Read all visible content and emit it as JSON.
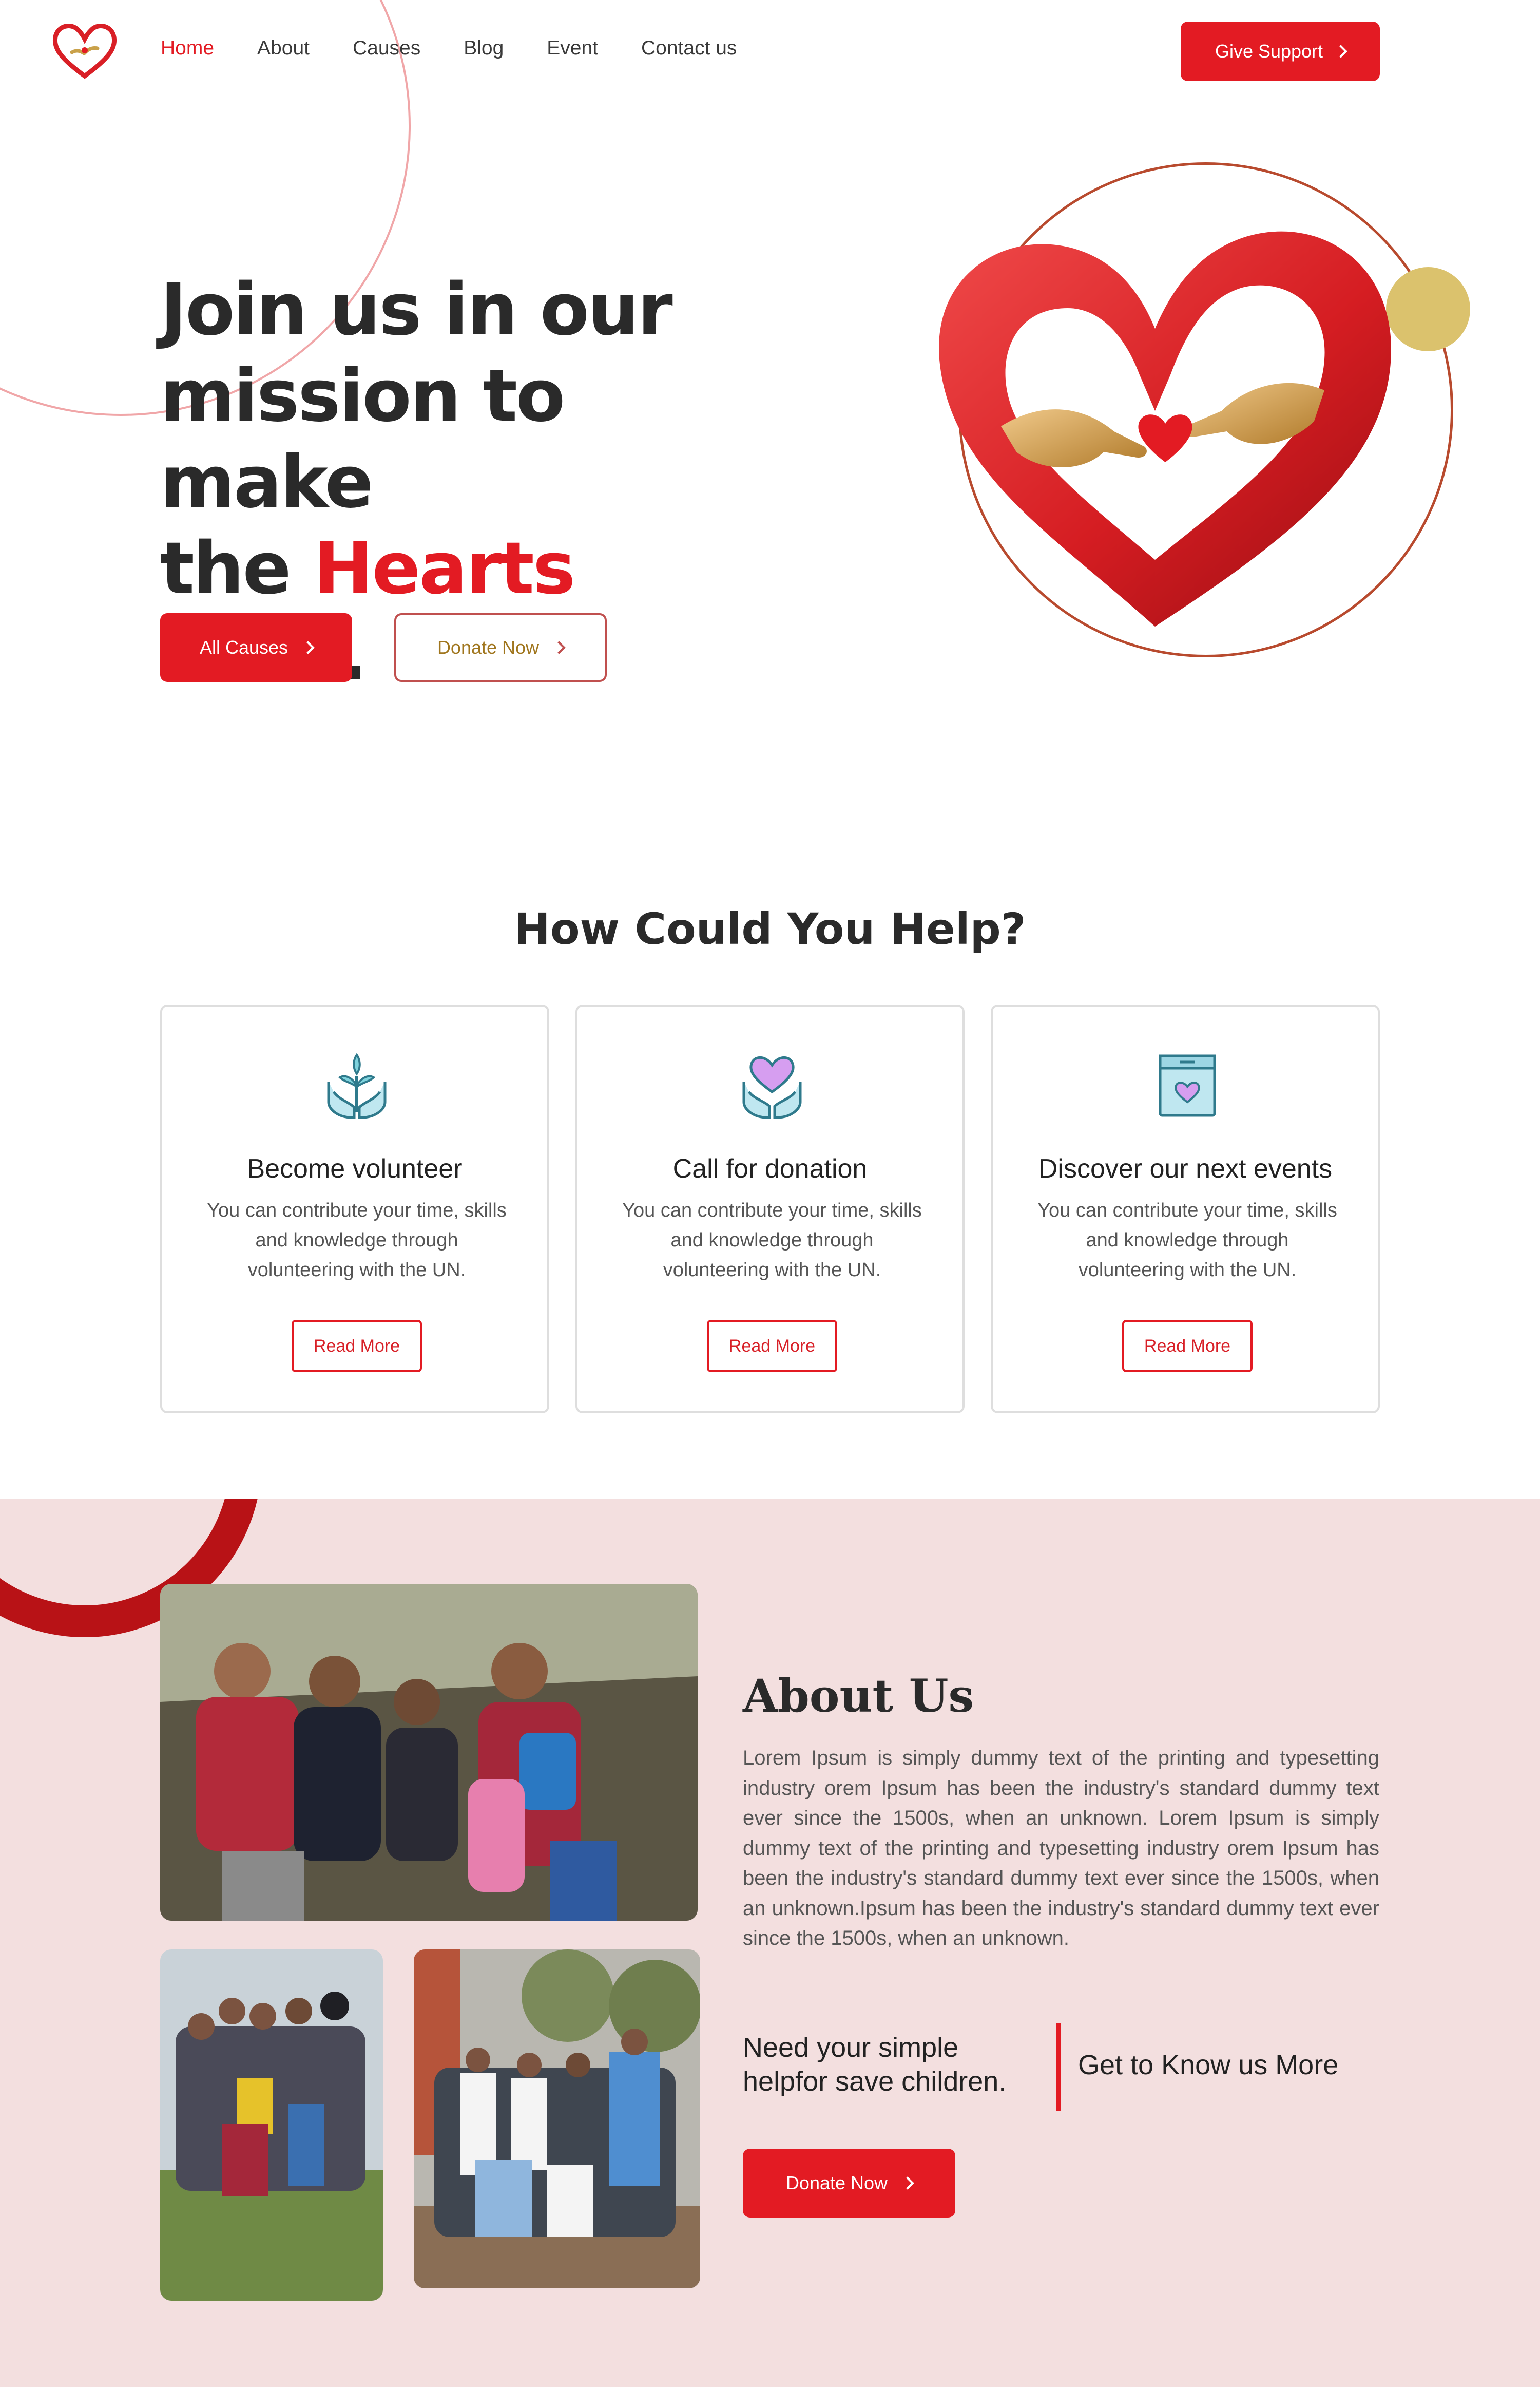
{
  "nav": {
    "links": [
      {
        "label": "Home",
        "active": true
      },
      {
        "label": "About",
        "active": false
      },
      {
        "label": "Causes",
        "active": false
      },
      {
        "label": "Blog",
        "active": false
      },
      {
        "label": "Event",
        "active": false
      },
      {
        "label": "Contact us",
        "active": false
      }
    ],
    "give_support_label": "Give Support"
  },
  "hero": {
    "title_line1": "Join us in our",
    "title_line2": "mission to make",
    "title_line3_pre": "the ",
    "title_line3_accent": "Hearts",
    "title_line3_post": " Beat.",
    "all_causes_label": "All Causes",
    "donate_now_label": "Donate Now"
  },
  "help": {
    "title": "How Could You Help?",
    "cards": [
      {
        "title": "Become volunteer",
        "text": "You can contribute your time, skills and knowledge through volunteering with the UN.",
        "button": "Read More",
        "icon": "volunteer-plant-hands-icon"
      },
      {
        "title": "Call for donation",
        "text": "You can contribute your time, skills and knowledge through volunteering with the UN.",
        "button": "Read More",
        "icon": "heart-hands-icon"
      },
      {
        "title": "Discover our next events",
        "text": "You can contribute your time, skills and knowledge through volunteering with the UN.",
        "button": "Read More",
        "icon": "donation-box-icon"
      }
    ]
  },
  "about": {
    "title": "About Us",
    "text": "Lorem Ipsum is simply dummy text of the printing and typesetting industry orem Ipsum has been the industry's standard dummy text ever since the 1500s, when an unknown. Lorem Ipsum is simply dummy text of the printing and typesetting industry orem Ipsum has been the industry's standard dummy text ever since the 1500s, when an unknown.Ipsum has been the industry's standard dummy text ever since the 1500s, when an unknown.",
    "need_text": "Need your simple helpfor save children.",
    "know_more_label": "Get to Know us More",
    "donate_now_label": "Donate Now"
  },
  "colors": {
    "accent": "#e31b23",
    "about_bg": "#f3dfdf",
    "gold": "#dbc26d"
  }
}
